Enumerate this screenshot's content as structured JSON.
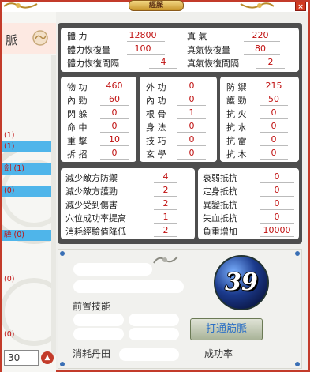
{
  "window": {
    "title": "經脈",
    "close_icon": "×",
    "accent": "#c33b2a"
  },
  "left_panel": {
    "header": "脈",
    "items": [
      {
        "text": "(1)",
        "highlight": false
      },
      {
        "text": "(1)",
        "highlight": true
      },
      {
        "text": "劍 (1)",
        "highlight": true
      },
      {
        "text": "(0)",
        "highlight": true
      },
      {
        "text": "驊 (0)",
        "highlight": true
      },
      {
        "text": "(0)",
        "highlight": false
      },
      {
        "text": "(0)",
        "highlight": false
      }
    ],
    "count_value": "30",
    "count_arrow": "▲"
  },
  "stats": {
    "top": [
      {
        "label": "體 力",
        "value": "12800",
        "label2": "真 氣",
        "value2": "220"
      },
      {
        "label": "體力恢復量",
        "value": "100",
        "label2": "真氣恢復量",
        "value2": "80"
      },
      {
        "label": "體力恢復間隔",
        "value": "4",
        "label2": "真氣恢復間隔",
        "value2": "2"
      }
    ],
    "col1": [
      {
        "label": "物 功",
        "value": "460"
      },
      {
        "label": "內 勁",
        "value": "60"
      },
      {
        "label": "閃 躲",
        "value": "0"
      },
      {
        "label": "命 中",
        "value": "0"
      },
      {
        "label": "重 擊",
        "value": "10"
      },
      {
        "label": "拆 招",
        "value": "0"
      }
    ],
    "col2": [
      {
        "label": "外 功",
        "value": "0"
      },
      {
        "label": "內 功",
        "value": "0"
      },
      {
        "label": "根 骨",
        "value": "1"
      },
      {
        "label": "身 法",
        "value": "0"
      },
      {
        "label": "技 巧",
        "value": "0"
      },
      {
        "label": "玄 學",
        "value": "0"
      }
    ],
    "col3": [
      {
        "label": "防 禦",
        "value": "215"
      },
      {
        "label": "護 勁",
        "value": "50"
      },
      {
        "label": "抗 火",
        "value": "0"
      },
      {
        "label": "抗 水",
        "value": "0"
      },
      {
        "label": "抗 雷",
        "value": "0"
      },
      {
        "label": "抗 木",
        "value": "0"
      }
    ],
    "bottom_left": [
      {
        "label": "減少敵方防禦",
        "value": "4"
      },
      {
        "label": "減少敵方護勁",
        "value": "2"
      },
      {
        "label": "減少受到傷害",
        "value": "2"
      },
      {
        "label": "穴位成功率提高",
        "value": "1"
      },
      {
        "label": "消耗經驗值降低",
        "value": "2"
      }
    ],
    "bottom_right": [
      {
        "label": "衰弱抵抗",
        "value": "0"
      },
      {
        "label": "定身抵抗",
        "value": "0"
      },
      {
        "label": "異變抵抗",
        "value": "0"
      },
      {
        "label": "失血抵抗",
        "value": "0"
      },
      {
        "label": "負重增加",
        "value": "10000"
      }
    ]
  },
  "skill": {
    "level": "39",
    "prereq_label": "前置技能",
    "cost_label": "消耗丹田",
    "rate_label": "成功率",
    "unlock_button": "打通筋脈"
  }
}
